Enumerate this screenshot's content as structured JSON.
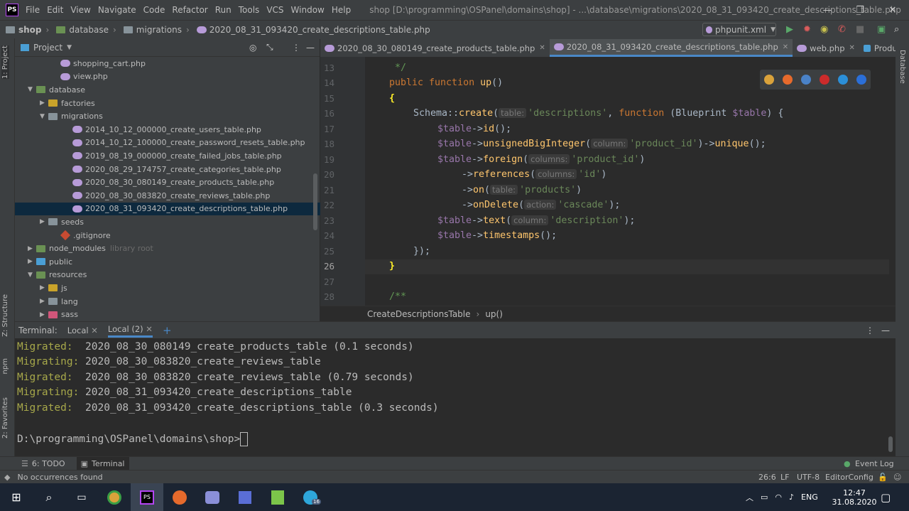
{
  "menubar": {
    "logo": "PS",
    "items": [
      "File",
      "Edit",
      "View",
      "Navigate",
      "Code",
      "Refactor",
      "Run",
      "Tools",
      "VCS",
      "Window",
      "Help"
    ],
    "title": "shop [D:\\programming\\OSPanel\\domains\\shop] - ...\\database\\migrations\\2020_08_31_093420_create_descriptions_table.php",
    "window_buttons": [
      "—",
      "❐",
      "✕"
    ]
  },
  "navbar": {
    "crumbs": [
      "shop",
      "database",
      "migrations",
      "2020_08_31_093420_create_descriptions_table.php"
    ],
    "run_config": "phpunit.xml"
  },
  "left_strip": {
    "project": "1: Project",
    "structure": "Z: Structure",
    "npm": "npm",
    "favorites": "2: Favorites"
  },
  "right_strip": {
    "database": "Database"
  },
  "project_panel": {
    "title": "Project",
    "rows": [
      {
        "label": "shopping_cart.php",
        "type": "php",
        "indent": 3
      },
      {
        "label": "view.php",
        "type": "php",
        "indent": 3
      },
      {
        "label": "database",
        "type": "folder-green",
        "indent": 1,
        "arrow": "open"
      },
      {
        "label": "factories",
        "type": "folder-yellow",
        "indent": 2,
        "arrow": "closed"
      },
      {
        "label": "migrations",
        "type": "folder",
        "indent": 2,
        "arrow": "open"
      },
      {
        "label": "2014_10_12_000000_create_users_table.php",
        "type": "php",
        "indent": 4
      },
      {
        "label": "2014_10_12_100000_create_password_resets_table.php",
        "type": "php",
        "indent": 4
      },
      {
        "label": "2019_08_19_000000_create_failed_jobs_table.php",
        "type": "php",
        "indent": 4
      },
      {
        "label": "2020_08_29_174757_create_categories_table.php",
        "type": "php",
        "indent": 4
      },
      {
        "label": "2020_08_30_080149_create_products_table.php",
        "type": "php",
        "indent": 4
      },
      {
        "label": "2020_08_30_083820_create_reviews_table.php",
        "type": "php",
        "indent": 4
      },
      {
        "label": "2020_08_31_093420_create_descriptions_table.php",
        "type": "php",
        "indent": 4,
        "selected": true
      },
      {
        "label": "seeds",
        "type": "folder",
        "indent": 2,
        "arrow": "closed"
      },
      {
        "label": ".gitignore",
        "type": "git",
        "indent": 3
      },
      {
        "label": "node_modules",
        "type": "folder-green",
        "indent": 1,
        "arrow": "closed",
        "extra": "library root"
      },
      {
        "label": "public",
        "type": "folder-blue",
        "indent": 1,
        "arrow": "closed"
      },
      {
        "label": "resources",
        "type": "folder-green",
        "indent": 1,
        "arrow": "open"
      },
      {
        "label": "js",
        "type": "folder-yellow",
        "indent": 2,
        "arrow": "closed"
      },
      {
        "label": "lang",
        "type": "folder",
        "indent": 2,
        "arrow": "closed"
      },
      {
        "label": "sass",
        "type": "folder-pink",
        "indent": 2,
        "arrow": "closed"
      }
    ]
  },
  "editor": {
    "tabs": [
      {
        "label": "2020_08_30_080149_create_products_table.php",
        "active": false
      },
      {
        "label": "2020_08_31_093420_create_descriptions_table.php",
        "active": true
      },
      {
        "label": "web.php",
        "active": false
      },
      {
        "label": "ProductController.",
        "active": false
      }
    ],
    "line_numbers": [
      "13",
      "14",
      "15",
      "16",
      "17",
      "18",
      "19",
      "20",
      "21",
      "22",
      "23",
      "24",
      "25",
      "26",
      "27",
      "28"
    ],
    "current_line": "26",
    "breadcrumb": [
      "CreateDescriptionsTable",
      "up()"
    ],
    "code": {
      "l13": "*/",
      "l14_kw": "public function",
      "l14_fn": "up",
      "l14_rest": "()",
      "l15": "{",
      "l16_a": "Schema::",
      "l16_fn": "create",
      "l16_hint": "table:",
      "l16_str": "'descriptions'",
      "l16_kw": "function",
      "l16_b": "(Blueprint ",
      "l16_var": "$table",
      "l16_c": ") {",
      "l17_var": "$table",
      "l17_arrow": "->",
      "l17_fn": "id",
      "l17_rest": "();",
      "l18_var": "$table",
      "l18_fn": "unsignedBigInteger",
      "l18_hint": "column:",
      "l18_str": "'product_id'",
      "l18_fn2": "unique",
      "l18_rest": "();",
      "l19_var": "$table",
      "l19_fn": "foreign",
      "l19_hint": "columns:",
      "l19_str": "'product_id'",
      "l20_fn": "references",
      "l20_hint": "columns:",
      "l20_str": "'id'",
      "l21_fn": "on",
      "l21_hint": "table:",
      "l21_str": "'products'",
      "l22_fn": "onDelete",
      "l22_hint": "action:",
      "l22_str": "'cascade'",
      "l23_var": "$table",
      "l23_fn": "text",
      "l23_hint": "column:",
      "l23_str": "'description'",
      "l24_var": "$table",
      "l24_fn": "timestamps",
      "l24_rest": "();",
      "l25": "});",
      "l26": "}",
      "l28": "/**"
    }
  },
  "terminal": {
    "label": "Terminal:",
    "tabs": [
      "Local",
      "Local (2)"
    ],
    "add": "+",
    "lines": [
      {
        "status": "Migrated:",
        "text": "2020_08_30_080149_create_products_table (0.1 seconds)"
      },
      {
        "status": "Migrating:",
        "text": "2020_08_30_083820_create_reviews_table"
      },
      {
        "status": "Migrated:",
        "text": "2020_08_30_083820_create_reviews_table (0.79 seconds)"
      },
      {
        "status": "Migrating:",
        "text": "2020_08_31_093420_create_descriptions_table"
      },
      {
        "status": "Migrated:",
        "text": "2020_08_31_093420_create_descriptions_table (0.3 seconds)"
      }
    ],
    "prompt": "D:\\programming\\OSPanel\\domains\\shop>"
  },
  "toolbar_bottom": {
    "todo": "6: TODO",
    "terminal": "Terminal",
    "event_log": "Event Log"
  },
  "status": {
    "message": "No occurrences found",
    "position": "26:6",
    "line_sep": "LF",
    "encoding": "UTF-8",
    "editorconfig": "EditorConfig"
  },
  "taskbar": {
    "lang": "ENG",
    "time": "12:47",
    "date": "31.08.2020",
    "telegram_badge": "16"
  }
}
